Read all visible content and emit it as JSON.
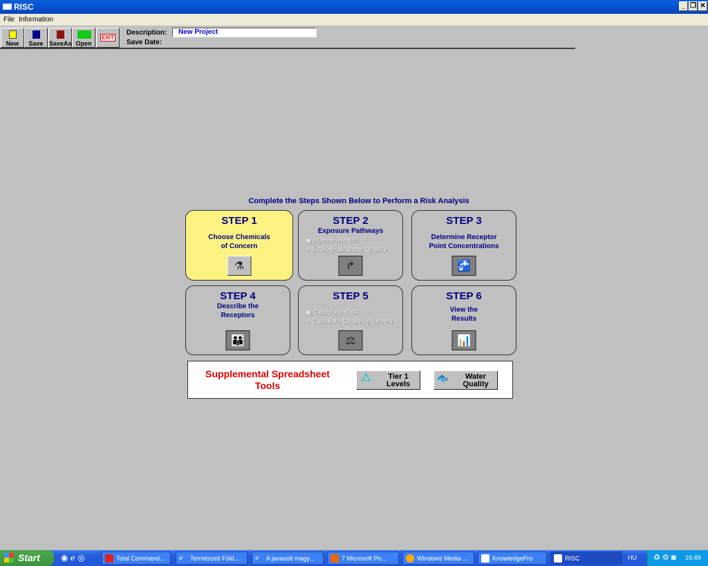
{
  "window": {
    "title": "RISC",
    "controls": [
      "_",
      "❐",
      "✕"
    ]
  },
  "menu": [
    "File",
    "Information"
  ],
  "toolbar": {
    "buttons": [
      "New",
      "Save",
      "SaveAs",
      "Open",
      "EXIT"
    ],
    "description_label": "Description:",
    "description_value": "New Project",
    "save_date_label": "Save Date:"
  },
  "main": {
    "heading": "Complete the Steps Shown Below to Perform a Risk Analysis",
    "steps": [
      {
        "title": "STEP 1",
        "sub": "Choose Chemicals of Concern",
        "icon": "flask-icon",
        "enabled": true
      },
      {
        "title": "STEP 2",
        "sub": "Exposure Pathways",
        "options": [
          "Human Health",
          "Ecological/Water Quality"
        ],
        "icon": "arrow-icon",
        "enabled": false
      },
      {
        "title": "STEP 3",
        "sub": "Determine Receptor Point Concentrations",
        "icon": "faucet-icon",
        "enabled": false
      },
      {
        "title": "STEP 4",
        "sub": "Describe the Receptors",
        "icon": "family-icon",
        "enabled": false
      },
      {
        "title": "STEP 5",
        "options": [
          "Calculate Risk",
          "Calculate Clean-up Levels"
        ],
        "icon": "scales-icon",
        "enabled": false
      },
      {
        "title": "STEP 6",
        "sub": "View the Results",
        "icon": "bar-chart-icon",
        "enabled": false
      }
    ],
    "supplemental": {
      "title": "Supplemental Spreadsheet Tools",
      "buttons": [
        "Tier 1 Levels",
        "Water Quality"
      ]
    }
  },
  "taskbar": {
    "start": "Start",
    "tasks": [
      "Total Command...",
      "Természeti Föld...",
      "A javasolt magy...",
      "7 Microsoft Po...",
      "Windows Media ...",
      "KnowledgePro",
      "RISC"
    ],
    "language": "HU",
    "clock": "16:49"
  },
  "colors": {
    "active_step": "#fcf282",
    "step_text": "#000080",
    "supplemental_title": "#e00000"
  }
}
